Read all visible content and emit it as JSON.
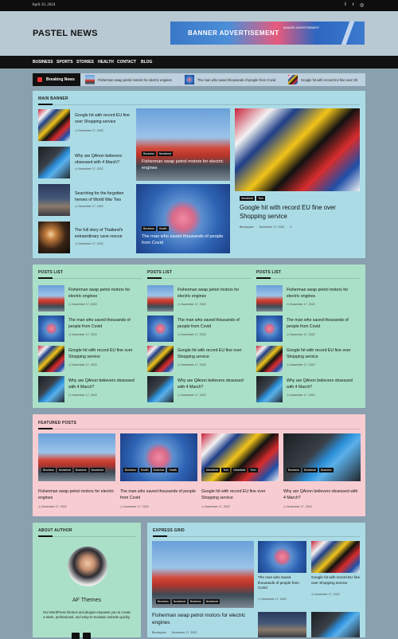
{
  "topbar": {
    "date": "April 10, 2024",
    "social": [
      "f",
      "t",
      "◎"
    ]
  },
  "site": {
    "title": "PASTEL NEWS"
  },
  "ad": {
    "headline": "BANNER ADVERTISEMENT",
    "sub": "BANNER ADVERTISEMENT"
  },
  "nav": [
    "BUSINESS",
    "SPORTS",
    "STORIES",
    "HEALTH",
    "CONTACT",
    "BLOG"
  ],
  "ticker": {
    "label": "Breaking News",
    "items": [
      "Fisherman swap petrol motors for electric engines",
      "The man who saved thousands of people from Covid",
      "Google hit with record EU fine over Sh"
    ]
  },
  "main_banner": {
    "heading": "MAIN BANNER",
    "list": [
      {
        "title": "Google hit with record EU fine over Shopping service",
        "date": "November 17, 2022"
      },
      {
        "title": "Why are QAnon believers obsessed with 4 March?",
        "date": "November 17, 2022"
      },
      {
        "title": "Searching for the forgotten heroes of World War Two",
        "date": "November 17, 2022"
      },
      {
        "title": "The full story of Thailand's extraordinary cave rescue",
        "date": "November 17, 2022"
      }
    ],
    "mid": [
      {
        "tags": [
          "Business",
          "Newsbeat"
        ],
        "title": "Fisherman swap petrol motors for electric engines"
      },
      {
        "tags": [
          "Business",
          "Health"
        ],
        "title": "The man who saved thousands of people from Covid"
      }
    ],
    "feature": {
      "tags": [
        "Newsbeat",
        "Tech"
      ],
      "title": "Google hit with record EU fine over Shopping service",
      "author": "Blockspare",
      "date": "November 17, 2022",
      "comments": "0"
    }
  },
  "posts_list": {
    "heading": "POSTS LIST",
    "items": [
      {
        "title": "Fisherman swap petrol motors for electric engines",
        "date": "November 17, 2022"
      },
      {
        "title": "The man who saved thousands of people from Covid",
        "date": "November 17, 2022"
      },
      {
        "title": "Google hit with record EU fine over Shopping service",
        "date": "November 17, 2022"
      },
      {
        "title": "Why are QAnon believers obsessed with 4 March?",
        "date": "November 17, 2022"
      }
    ]
  },
  "featured": {
    "heading": "FEATURED POSTS",
    "items": [
      {
        "tags": [
          "Business",
          "Newsbeat",
          "Business",
          "Newsbeat"
        ],
        "title": "Fisherman swap petrol motors for electric engines",
        "date": "November 17, 2022"
      },
      {
        "tags": [
          "Business",
          "Health",
          "Business",
          "Health"
        ],
        "title": "The man who saved thousands of people from Covid",
        "date": "November 17, 2022"
      },
      {
        "tags": [
          "Newsbeat",
          "Tech",
          "Newsbeat",
          "Tech"
        ],
        "title": "Google hit with record EU fine over Shopping service",
        "date": "November 17, 2022"
      },
      {
        "tags": [
          "Business",
          "Newsbeat",
          "Business"
        ],
        "title": "Why are QAnon believers obsessed with 4 March?",
        "date": "November 17, 2022"
      }
    ]
  },
  "about": {
    "heading": "ABOUT AUTHOR",
    "name": "AF Themes",
    "text": "Our WordPress themes and plugins empower you to create a sleek, professional, and easy-to-maintain website quickly."
  },
  "express": {
    "heading": "EXPRESS GRID",
    "main": {
      "tags": [
        "Business",
        "Newsbeat",
        "Business",
        "Newsbeat"
      ],
      "title": "Fisherman swap petrol motors for electric engines",
      "author": "Blockspare",
      "date": "November 17, 2022"
    },
    "small": [
      {
        "title": "The man who saved thousands of people from Covid",
        "date": "November 17, 2022"
      },
      {
        "title": "Google hit with record EU fine over Shopping service",
        "date": "November 17, 2022"
      }
    ]
  },
  "colors": {
    "main_banner": "#abdce6",
    "posts_list": "#abe0c8",
    "featured": "#f8cdd2",
    "about": "#abe0c8",
    "express": "#abdce6"
  }
}
